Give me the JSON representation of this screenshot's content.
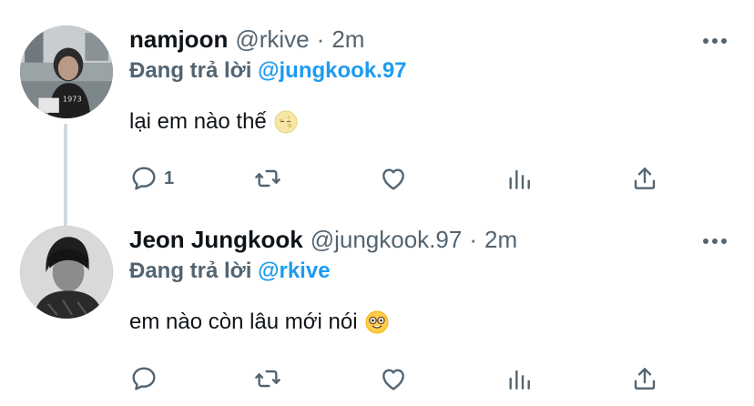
{
  "tweets": [
    {
      "name": "namjoon",
      "handle": "@rkive",
      "separator": "·",
      "time": "2m",
      "reply_prefix": "Đang trả lời",
      "reply_to": "@jungkook.97",
      "text": "lại em nào thế",
      "emoji": "moon-face-emoji",
      "reply_count": "1"
    },
    {
      "name": "Jeon Jungkook",
      "handle": "@jungkook.97",
      "separator": "·",
      "time": "2m",
      "reply_prefix": "Đang trả lời",
      "reply_to": "@rkive",
      "text": "em nào còn lâu mới nói",
      "emoji": "nerd-face-emoji",
      "reply_count": ""
    }
  ],
  "icons": {
    "reply": "reply-icon",
    "retweet": "retweet-icon",
    "like": "heart-icon",
    "stats": "stats-icon",
    "share": "share-icon",
    "more": "more-icon"
  },
  "colors": {
    "accent": "#1d9bf0",
    "secondary_text": "#536471",
    "primary_text": "#0f1419",
    "thread_line": "#cfd9de"
  }
}
